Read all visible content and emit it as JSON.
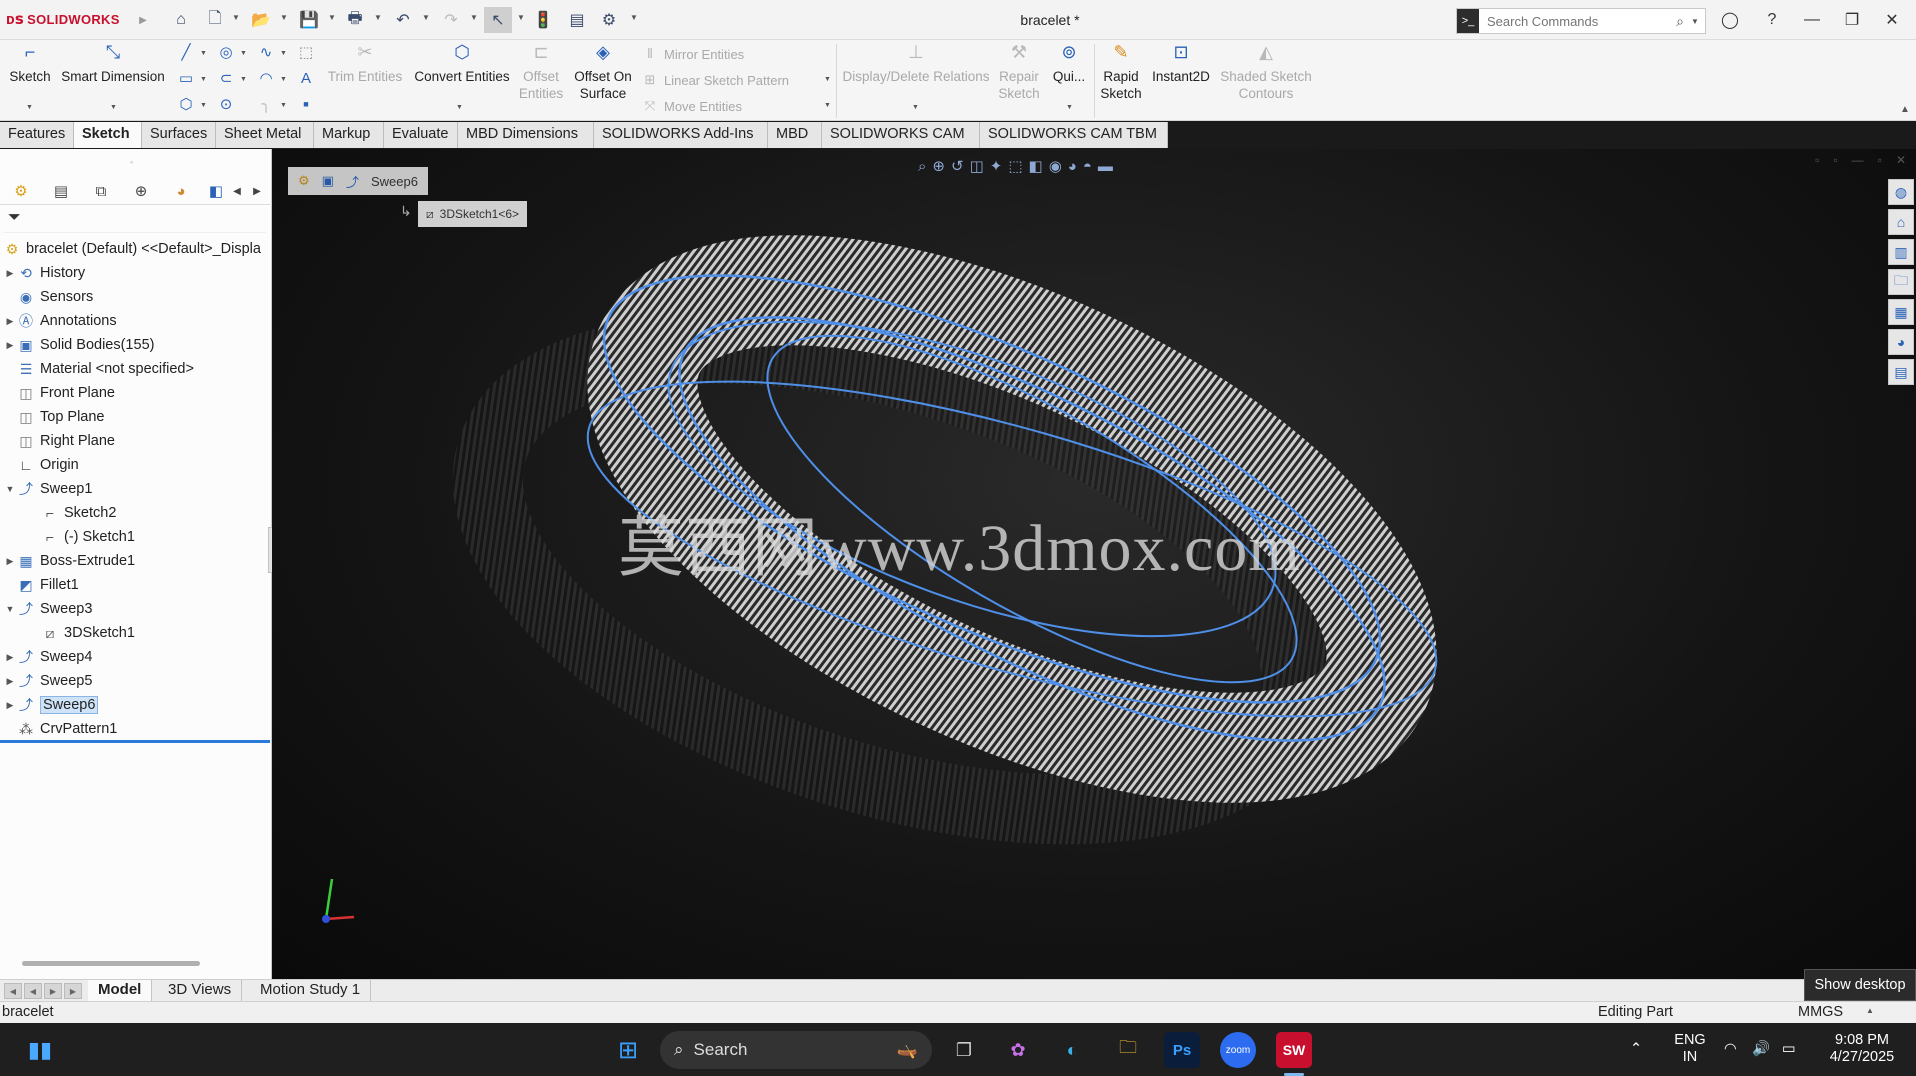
{
  "titlebar": {
    "app_name": "SOLIDWORKS",
    "doc_title": "bracelet *",
    "search_placeholder": "Search Commands"
  },
  "ribbon": {
    "sketch": "Sketch",
    "smart_dim_1": "Smart",
    "smart_dim_2": "Dimension",
    "trim": "Trim Entities",
    "convert": "Convert Entities",
    "offset_1": "Offset",
    "offset_2": "Entities",
    "offset_surf_1": "Offset On",
    "offset_surf_2": "Surface",
    "mirror": "Mirror Entities",
    "linear": "Linear Sketch Pattern",
    "move": "Move Entities",
    "display_rel": "Display/Delete Relations",
    "repair_1": "Repair",
    "repair_2": "Sketch",
    "quick": "Qui...",
    "rapid_1": "Rapid",
    "rapid_2": "Sketch",
    "instant2d": "Instant2D",
    "shaded_1": "Shaded Sketch",
    "shaded_2": "Contours"
  },
  "tabs": [
    "Features",
    "Sketch",
    "Surfaces",
    "Sheet Metal",
    "Markup",
    "Evaluate",
    "MBD Dimensions",
    "SOLIDWORKS Add-Ins",
    "MBD",
    "SOLIDWORKS CAM",
    "SOLIDWORKS CAM TBM"
  ],
  "tree": {
    "root": "bracelet (Default) <<Default>_Displa",
    "items": [
      {
        "label": "History"
      },
      {
        "label": "Sensors"
      },
      {
        "label": "Annotations"
      },
      {
        "label": "Solid Bodies(155)"
      },
      {
        "label": "Material <not specified>"
      },
      {
        "label": "Front Plane"
      },
      {
        "label": "Top Plane"
      },
      {
        "label": "Right Plane"
      },
      {
        "label": "Origin"
      },
      {
        "label": "Sweep1"
      },
      {
        "label": "Sketch2"
      },
      {
        "label": "(-) Sketch1"
      },
      {
        "label": "Boss-Extrude1"
      },
      {
        "label": "Fillet1"
      },
      {
        "label": "Sweep3"
      },
      {
        "label": "3DSketch1"
      },
      {
        "label": "Sweep4"
      },
      {
        "label": "Sweep5"
      },
      {
        "label": "Sweep6"
      },
      {
        "label": "CrvPattern1"
      }
    ]
  },
  "viewport": {
    "breadcrumb_feature": "Sweep6",
    "breadcrumb_sketch": "3DSketch1<6>",
    "watermark": "莫西网www.3dmox.com"
  },
  "bottom_tabs": [
    "Model",
    "3D Views",
    "Motion Study 1"
  ],
  "show_desktop": "Show desktop",
  "status": {
    "doc": "bracelet",
    "mode": "Editing Part",
    "units": "MMGS"
  },
  "taskbar": {
    "search": "Search",
    "lang_1": "ENG",
    "lang_2": "IN",
    "time": "9:08 PM",
    "date": "4/27/2025"
  }
}
